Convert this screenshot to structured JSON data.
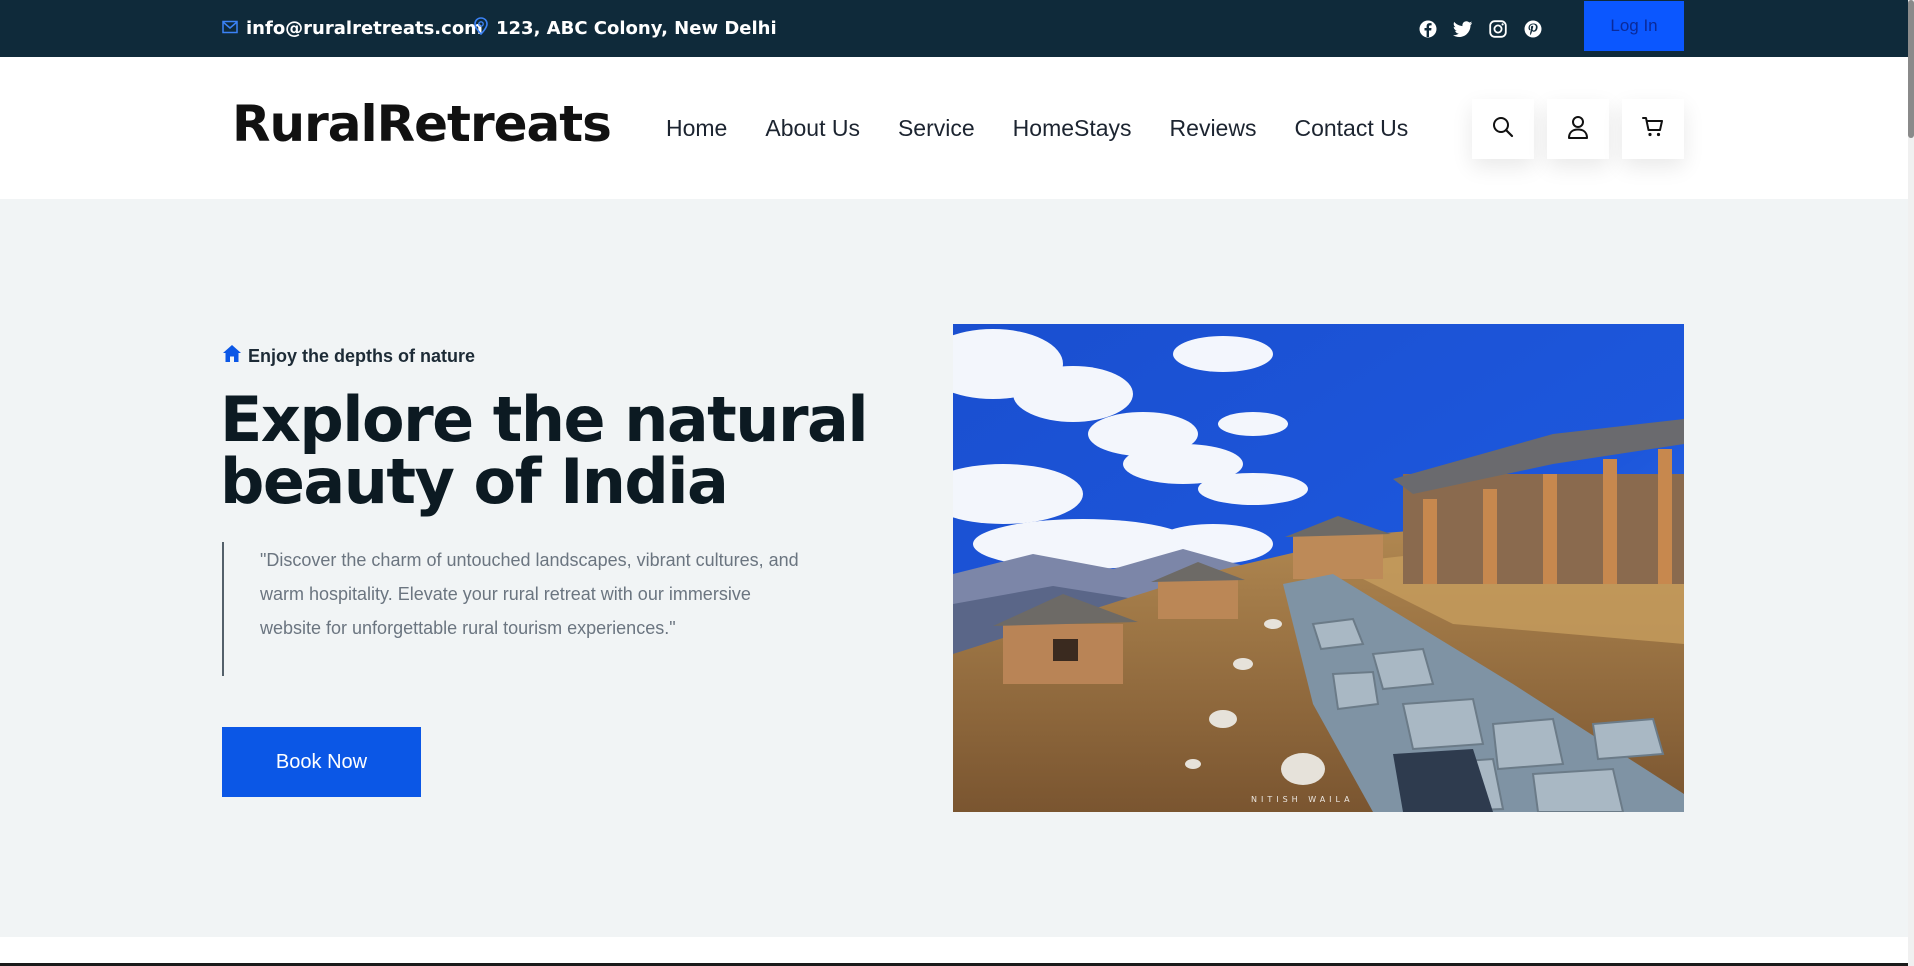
{
  "topbar": {
    "email": "info@ruralretreats.com",
    "address": "123, ABC Colony, New Delhi",
    "socials": [
      "facebook-icon",
      "twitter-icon",
      "instagram-icon",
      "pinterest-icon"
    ],
    "login_label": "Log In"
  },
  "header": {
    "logo": "RuralRetreats",
    "nav": [
      "Home",
      "About Us",
      "Service",
      "HomeStays",
      "Reviews",
      "Contact Us"
    ],
    "icons": [
      "search-icon",
      "user-icon",
      "cart-icon"
    ]
  },
  "hero": {
    "tagline": "Enjoy the depths of nature",
    "headline": "Explore the natural beauty of India",
    "quote": "\"Discover the charm of untouched landscapes, vibrant cultures, and warm hospitality. Elevate your rural retreat with our immersive website for unforgettable rural tourism experiences.\"",
    "cta_label": "Book Now",
    "image_watermark": "NITISH WAILA"
  },
  "colors": {
    "topbar_bg": "#0f2a3a",
    "accent": "#0b57e6",
    "hero_bg": "#f1f4f5",
    "heading": "#0c1a22"
  }
}
